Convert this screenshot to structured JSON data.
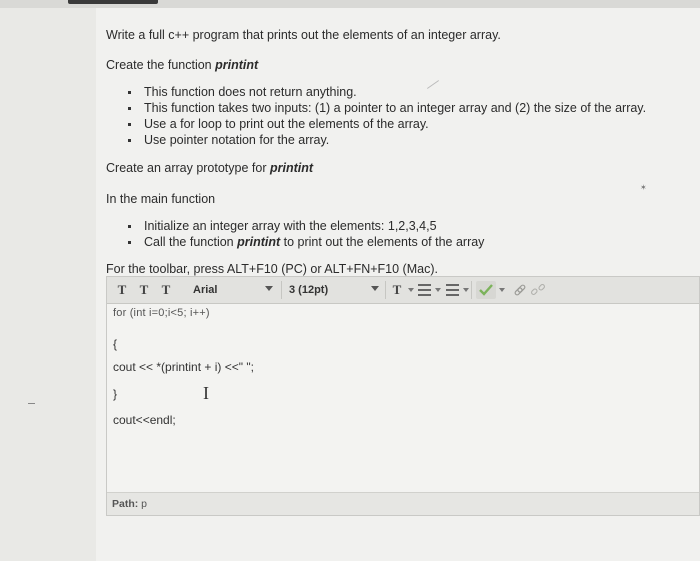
{
  "question": {
    "intro": "Write a full c++ program that prints out the elements of an integer array.",
    "create_function_prefix": "Create the function ",
    "function_name": "printint",
    "function_bullets": [
      "This function does not return anything.",
      "This function takes two inputs: (1) a pointer to an integer array and (2) the size of the array.",
      "Use a for loop to print out the elements of the array.",
      "Use pointer notation for the array."
    ],
    "prototype_prefix": "Create an array prototype for ",
    "main_heading": "In the main function",
    "main_bullets": {
      "first": "Initialize an integer array with the elements: 1,2,3,4,5",
      "second_prefix": "Call the function ",
      "second_fn": "printint",
      "second_suffix": " to print out the elements of the array"
    },
    "toolbar_hint": "For the toolbar, press ALT+F10 (PC) or ALT+FN+F10 (Mac)."
  },
  "toolbar": {
    "font_family": "Arial",
    "font_size": "3 (12pt)",
    "style_button_glyph": "T",
    "text_color_glyph": "T"
  },
  "editor": {
    "lines": {
      "for_clipped": "for (int i=0;i<5; i++)",
      "open_brace": "{",
      "cout_line": "cout << *(printint + i) <<\" \";",
      "close_brace": "}",
      "endl_line": "cout<<endl;"
    },
    "path_label": "Path: ",
    "path_value": "p"
  },
  "icons": {
    "style-buttons": "text-style-icon",
    "text-color": "text-color-icon",
    "bullet-list": "bullet-list-icon",
    "numbered-list": "numbered-list-icon",
    "spellcheck": "spellcheck-icon",
    "link": "link-icon",
    "unlink": "unlink-icon"
  },
  "colors": {
    "background": "#f1f1ef",
    "toolbar": "#e2e2df",
    "spellcheck_green": "#7cb35b"
  }
}
